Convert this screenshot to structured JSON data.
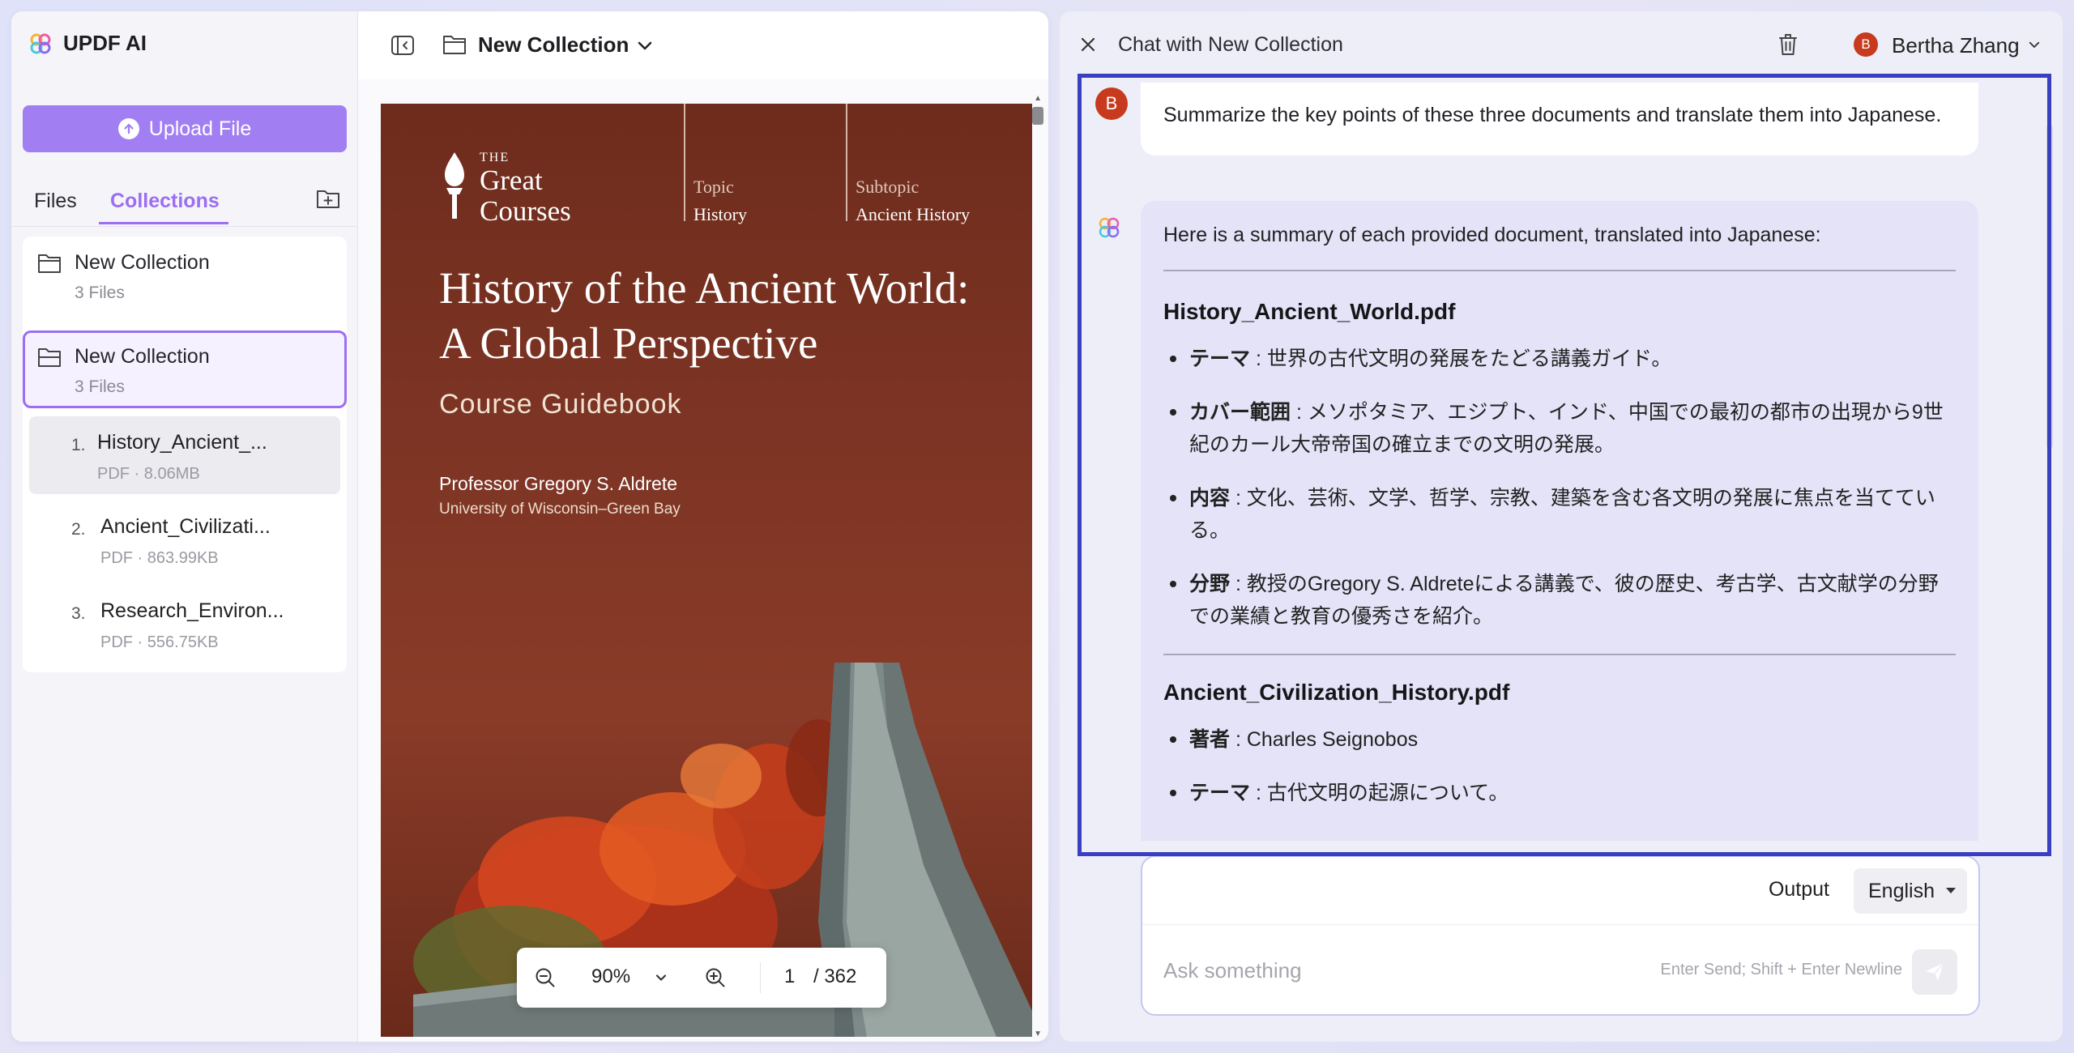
{
  "app": {
    "name": "UPDF AI",
    "upload_label": "Upload File",
    "tabs": {
      "files": "Files",
      "collections": "Collections"
    }
  },
  "collections": [
    {
      "name": "New Collection",
      "count": "3 Files"
    },
    {
      "name": "New Collection",
      "count": "3 Files"
    }
  ],
  "files": [
    {
      "num": "1.",
      "name": "History_Ancient_...",
      "meta": "PDF · 8.06MB"
    },
    {
      "num": "2.",
      "name": "Ancient_Civilizati...",
      "meta": "PDF · 863.99KB"
    },
    {
      "num": "3.",
      "name": "Research_Environ...",
      "meta": "PDF · 556.75KB"
    }
  ],
  "doc_toolbar": {
    "title": "New Collection"
  },
  "pdf": {
    "logo_the": "THE",
    "logo_line1": "Great",
    "logo_line2": "Courses",
    "topic_label": "Topic",
    "topic_value": "History",
    "subtopic_label": "Subtopic",
    "subtopic_value": "Ancient History",
    "title_line1": "History of the Ancient World:",
    "title_line2": "A Global Perspective",
    "subtitle": "Course Guidebook",
    "professor": "Professor Gregory S. Aldrete",
    "university": "University of Wisconsin–Green Bay"
  },
  "zoom": {
    "level": "90%",
    "page": "1",
    "total": "/ 362"
  },
  "chat": {
    "header_title": "Chat with New Collection",
    "user_name": "Bertha Zhang",
    "user_initial": "B",
    "user_message": "Summarize the key points of these three documents and translate them into Japanese.",
    "ai_intro": "Here is a summary of each provided document, translated into Japanese:",
    "sections": [
      {
        "heading": "History_Ancient_World.pdf",
        "items": [
          {
            "label": "テーマ",
            "text": " : 世界の古代文明の発展をたどる講義ガイド。"
          },
          {
            "label": "カバー範囲",
            "text": " : メソポタミア、エジプト、インド、中国での最初の都市の出現から9世紀のカール大帝帝国の確立までの文明の発展。"
          },
          {
            "label": "内容",
            "text": " : 文化、芸術、文学、哲学、宗教、建築を含む各文明の発展に焦点を当てている。"
          },
          {
            "label": "分野",
            "text": " : 教授のGregory S. Aldreteによる講義で、彼の歴史、考古学、古文献学の分野での業績と教育の優秀さを紹介。"
          }
        ]
      },
      {
        "heading": "Ancient_Civilization_History.pdf",
        "items": [
          {
            "label": "著者",
            "text": " : Charles Seignobos"
          },
          {
            "label": "テーマ",
            "text": " : 古代文明の起源について。"
          }
        ]
      }
    ],
    "output_label": "Output",
    "output_language": "English",
    "input_placeholder": "Ask something",
    "input_hint": "Enter Send; Shift + Enter Newline"
  },
  "colors": {
    "accent": "#9b6ef2",
    "upload_button": "#a27ef3",
    "focus_outline": "#3a3ec0",
    "avatar": "#c73a1e",
    "ai_bubble": "#e4e3f8"
  },
  "icons": [
    "updf-logo-icon",
    "arrow-up-circle-icon",
    "folder-plus-icon",
    "folder-icon",
    "sidebar-collapse-icon",
    "chevron-down-icon",
    "zoom-out-icon",
    "zoom-in-icon",
    "close-icon",
    "trash-icon",
    "ai-assistant-icon",
    "send-icon"
  ]
}
